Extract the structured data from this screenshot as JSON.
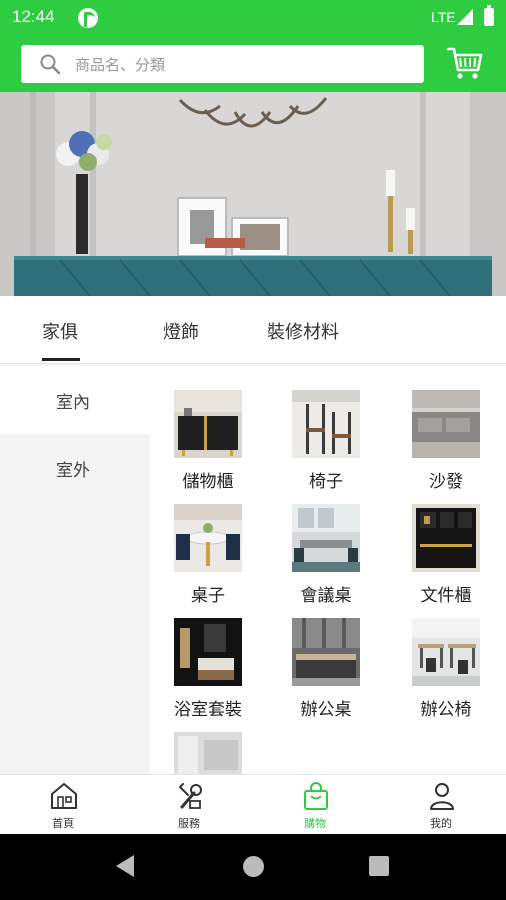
{
  "status_bar": {
    "time": "12:44",
    "network": "LTE"
  },
  "search": {
    "placeholder": "商品名、分類"
  },
  "tabs": [
    {
      "label": "家俱",
      "active": true
    },
    {
      "label": "燈飾",
      "active": false
    },
    {
      "label": "裝修材料",
      "active": false
    }
  ],
  "sidebar": [
    {
      "label": "室內",
      "active": true
    },
    {
      "label": "室外",
      "active": false
    }
  ],
  "products": [
    {
      "label": "儲物櫃"
    },
    {
      "label": "椅子"
    },
    {
      "label": "沙發"
    },
    {
      "label": "桌子"
    },
    {
      "label": "會議桌"
    },
    {
      "label": "文件櫃"
    },
    {
      "label": "浴室套裝"
    },
    {
      "label": "辦公桌"
    },
    {
      "label": "辦公椅"
    }
  ],
  "bottom_nav": [
    {
      "label": "首頁",
      "icon": "house-icon",
      "active": false
    },
    {
      "label": "服務",
      "icon": "tools-icon",
      "active": false
    },
    {
      "label": "購物",
      "icon": "shopping-bag-icon",
      "active": true
    },
    {
      "label": "我的",
      "icon": "person-icon",
      "active": false
    }
  ],
  "colors": {
    "accent": "#2ecc40",
    "text": "#222222",
    "sidebar_bg": "#f4f4f4"
  }
}
